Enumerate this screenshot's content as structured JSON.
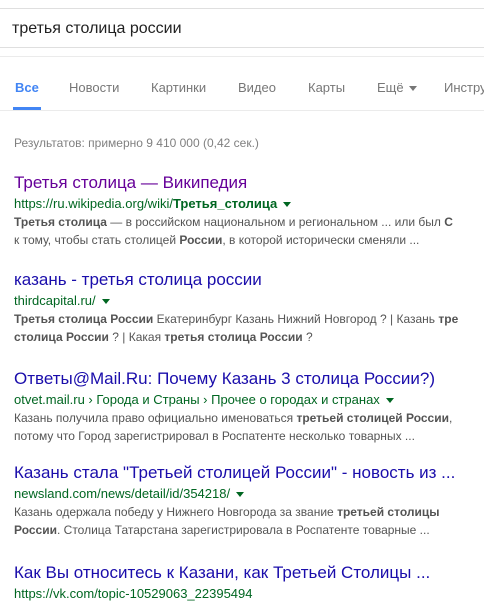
{
  "search": {
    "query": "третья столица россии"
  },
  "tabs": [
    {
      "label": "Все",
      "active": true
    },
    {
      "label": "Новости"
    },
    {
      "label": "Картинки"
    },
    {
      "label": "Видео"
    },
    {
      "label": "Карты"
    },
    {
      "label": "Ещё"
    },
    {
      "label": "Инстру"
    }
  ],
  "stats": "Результатов: примерно 9 410 000 (0,42 сек.)",
  "results": [
    {
      "title": "Третья столица — Википедия",
      "url_plain": "https://ru.wikipedia.org/wiki/",
      "url_bold": "Третья_столица",
      "snippet": [
        [
          [
            "b",
            "Третья столица"
          ],
          [
            "t",
            " — в российском национальном и региональном ... или был "
          ],
          [
            "b",
            "С"
          ]
        ],
        [
          [
            "t",
            "к тому, чтобы стать столицей "
          ],
          [
            "b",
            "России"
          ],
          [
            "t",
            ", в которой исторически сменяли  ..."
          ]
        ]
      ]
    },
    {
      "title": "казань - третья столица россии",
      "url_plain": "thirdcapital.ru/",
      "url_bold": "",
      "snippet": [
        [
          [
            "b",
            "Третья столица России"
          ],
          [
            "t",
            " Екатеринбург Казань Нижний Новгород ? | Казань "
          ],
          [
            "b",
            "тре"
          ]
        ],
        [
          [
            "b",
            "столица России"
          ],
          [
            "t",
            " ? | Какая "
          ],
          [
            "b",
            "третья столица России"
          ],
          [
            "t",
            " ?"
          ]
        ]
      ]
    },
    {
      "title": "Ответы@Mail.Ru: Почему Казань 3 столица России?)",
      "url_plain": "otvet.mail.ru › Города и Страны › Прочее о городах и странах",
      "url_bold": "",
      "snippet": [
        [
          [
            "t",
            "Казань получила право официально именоваться "
          ],
          [
            "b",
            "третьей столицей России"
          ],
          [
            "t",
            ","
          ]
        ],
        [
          [
            "t",
            "потому что Город зарегистрировал в Роспатенте несколько товарных  ..."
          ]
        ]
      ]
    },
    {
      "title": "Казань стала \"Третьей столицей России\" - новость из ...",
      "url_plain": "newsland.com/news/detail/id/354218/",
      "url_bold": "",
      "snippet": [
        [
          [
            "t",
            "Казань одержала победу у Нижнего Новгорода за звание "
          ],
          [
            "b",
            "третьей столицы"
          ]
        ],
        [
          [
            "b",
            "России"
          ],
          [
            "t",
            ". Столица Татарстана зарегистрировала в Роспатенте товарные  ..."
          ]
        ]
      ]
    },
    {
      "title": "Как Вы относитесь к Казани, как Третьей Столицы ...",
      "url_plain": "https://vk.com/topic-10529063_22395494",
      "url_bold": "",
      "snippet": []
    }
  ]
}
